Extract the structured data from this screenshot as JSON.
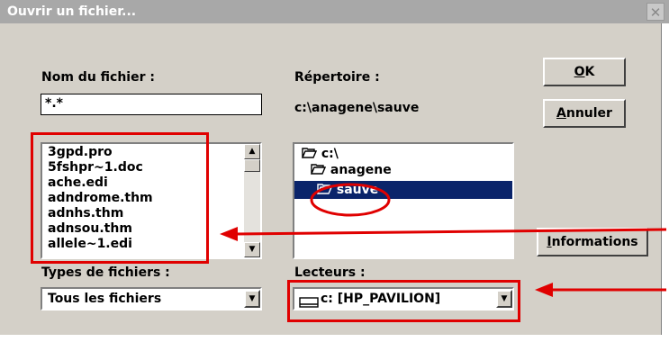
{
  "dialog": {
    "title": "Ouvrir un fichier...",
    "close_glyph": "✕"
  },
  "filename": {
    "label": "Nom du fichier :",
    "value": "*.*"
  },
  "files": [
    "3gpd.pro",
    "5fshpr~1.doc",
    "ache.edi",
    "adndrome.thm",
    "adnhs.thm",
    "adnsou.thm",
    "allele~1.edi"
  ],
  "directory": {
    "label": "Répertoire :",
    "path": "c:\\anagene\\sauve",
    "tree": [
      {
        "name": "c:\\",
        "icon": "open-folder-icon"
      },
      {
        "name": "anagene",
        "icon": "open-folder-icon"
      },
      {
        "name": "sauve",
        "icon": "open-folder-icon",
        "selected": true
      }
    ]
  },
  "file_types": {
    "label": "Types de fichiers :",
    "value": "Tous les fichiers"
  },
  "drives": {
    "label": "Lecteurs :",
    "value": "c: [HP_PAVILION]",
    "icon": "drive-icon"
  },
  "buttons": {
    "ok_first": "O",
    "ok_rest": "K",
    "cancel_first": "A",
    "cancel_rest": "nnuler",
    "info_first": "I",
    "info_rest": "nformations"
  },
  "colors": {
    "annotation": "#e00000",
    "selection": "#0a246a",
    "titlebar": "#a8a8a8"
  }
}
